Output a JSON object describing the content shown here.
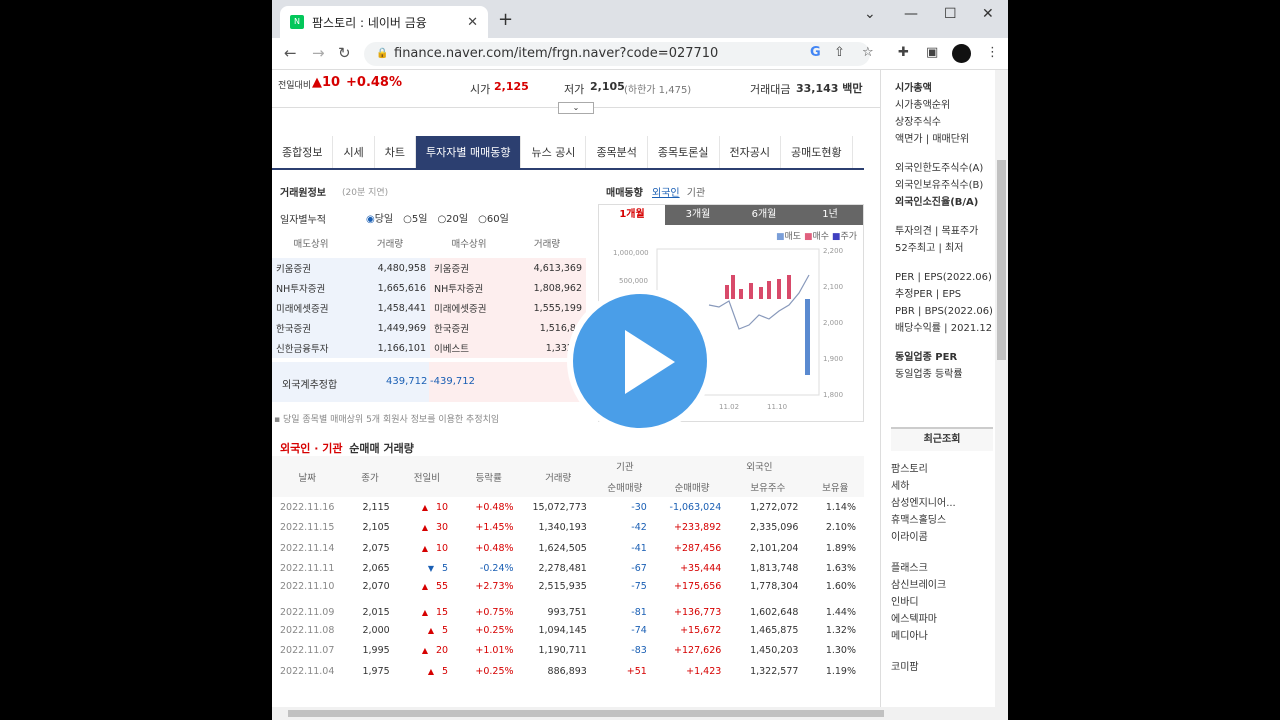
{
  "browser": {
    "tab_title": "팜스토리 : 네이버 금융",
    "url": "finance.naver.com/item/frgn.naver?code=027710"
  },
  "summary": {
    "change_label": "전일대비",
    "change_value": "▲10",
    "change_pct": "+0.48%",
    "open_label": "시가",
    "open_value": "2,125",
    "low_label": "저가",
    "low_value": "2,105",
    "lower_limit_label": "(하한가 1,475)",
    "amount_label": "거래대금",
    "amount_value": "33,143 백만"
  },
  "tabs": [
    "종합정보",
    "시세",
    "차트",
    "투자자별 매매동향",
    "뉴스 공시",
    "종목분석",
    "종목토론실",
    "전자공시",
    "공매도현황"
  ],
  "trade": {
    "title": "거래원정보",
    "delay": "(20분 지연)",
    "accum_label": "일자별누적",
    "radios": [
      "당일",
      "5일",
      "20일",
      "60일"
    ],
    "headers": [
      "매도상위",
      "거래량",
      "매수상위",
      "거래량"
    ],
    "rows": [
      [
        "키움증권",
        "4,480,958",
        "키움증권",
        "4,613,369"
      ],
      [
        "NH투자증권",
        "1,665,616",
        "NH투자증권",
        "1,808,962"
      ],
      [
        "미래에셋증권",
        "1,458,441",
        "미래에셋증권",
        "1,555,199"
      ],
      [
        "한국증권",
        "1,449,969",
        "한국증권",
        "1,516,86"
      ],
      [
        "신한금융투자",
        "1,166,101",
        "이베스트",
        "1,332,7"
      ]
    ],
    "foreign_label": "외국계추정합",
    "foreign_sell": "439,712",
    "foreign_buy": "-439,712",
    "note": "당일 종목별 매매상위 5개 회원사 정보를 이용한 추정치임"
  },
  "chart_panel": {
    "title": "매매동향",
    "opt_foreign": "외국인",
    "opt_inst": "기관",
    "tabs": [
      "1개월",
      "3개월",
      "6개월",
      "1년"
    ],
    "legend": [
      "매도",
      "매수",
      "주가"
    ]
  },
  "chart_data": {
    "type": "bar",
    "y_left_ticks": [
      "1,000,000",
      "500,000"
    ],
    "y_right_ticks": [
      "2,200",
      "2,100",
      "2,000",
      "1,900",
      "1,800"
    ],
    "x_ticks": [
      "11.02",
      "11.10"
    ]
  },
  "detail": {
    "title_a": "외국인 · 기관",
    "title_b": "순매매 거래량",
    "group_inst": "기관",
    "group_foreign": "외국인",
    "headers": [
      "날짜",
      "종가",
      "전일비",
      "등락률",
      "거래량",
      "순매매량",
      "순매매량",
      "보유주수",
      "보유율"
    ],
    "rows": [
      [
        "2022.11.16",
        "2,115",
        "▲",
        "10",
        "+0.48%",
        "15,072,773",
        "-30",
        "-1,063,024",
        "1,272,072",
        "1.14%"
      ],
      [
        "2022.11.15",
        "2,105",
        "▲",
        "30",
        "+1.45%",
        "1,340,193",
        "-42",
        "+233,892",
        "2,335,096",
        "2.10%"
      ],
      [
        "2022.11.14",
        "2,075",
        "▲",
        "10",
        "+0.48%",
        "1,624,505",
        "-41",
        "+287,456",
        "2,101,204",
        "1.89%"
      ],
      [
        "2022.11.11",
        "2,065",
        "▼",
        "5",
        "-0.24%",
        "2,278,481",
        "-67",
        "+35,444",
        "1,813,748",
        "1.63%"
      ],
      [
        "2022.11.10",
        "2,070",
        "▲",
        "55",
        "+2.73%",
        "2,515,935",
        "-75",
        "+175,656",
        "1,778,304",
        "1.60%"
      ],
      [
        "2022.11.09",
        "2,015",
        "▲",
        "15",
        "+0.75%",
        "993,751",
        "-81",
        "+136,773",
        "1,602,648",
        "1.44%"
      ],
      [
        "2022.11.08",
        "2,000",
        "▲",
        "5",
        "+0.25%",
        "1,094,145",
        "-74",
        "+15,672",
        "1,465,875",
        "1.32%"
      ],
      [
        "2022.11.07",
        "1,995",
        "▲",
        "20",
        "+1.01%",
        "1,190,711",
        "-83",
        "+127,626",
        "1,450,203",
        "1.30%"
      ],
      [
        "2022.11.04",
        "1,975",
        "▲",
        "5",
        "+0.25%",
        "886,893",
        "+51",
        "+1,423",
        "1,322,577",
        "1.19%"
      ]
    ]
  },
  "sidebar": {
    "group1": [
      "시가총액",
      "시가총액순위",
      "상장주식수",
      "액면가 | 매매단위"
    ],
    "group2": [
      "외국인한도주식수(A)",
      "외국인보유주식수(B)",
      "외국인소진율(B/A)"
    ],
    "group3": [
      "투자의견 | 목표주가",
      "52주최고 | 최저"
    ],
    "group4": [
      "PER | EPS(2022.06)",
      "추정PER | EPS",
      "PBR | BPS(2022.06)",
      "배당수익률 | 2021.12"
    ],
    "group5": [
      "동일업종 PER",
      "동일업종 등락률"
    ],
    "recent_title": "최근조회",
    "recent": [
      "팜스토리",
      "세하",
      "삼성엔지니어...",
      "휴맥스홀딩스",
      "이라이콤",
      "플래스크",
      "삼신브레이크",
      "인바디",
      "에스텍파마",
      "메디아나",
      "코미팜"
    ]
  }
}
